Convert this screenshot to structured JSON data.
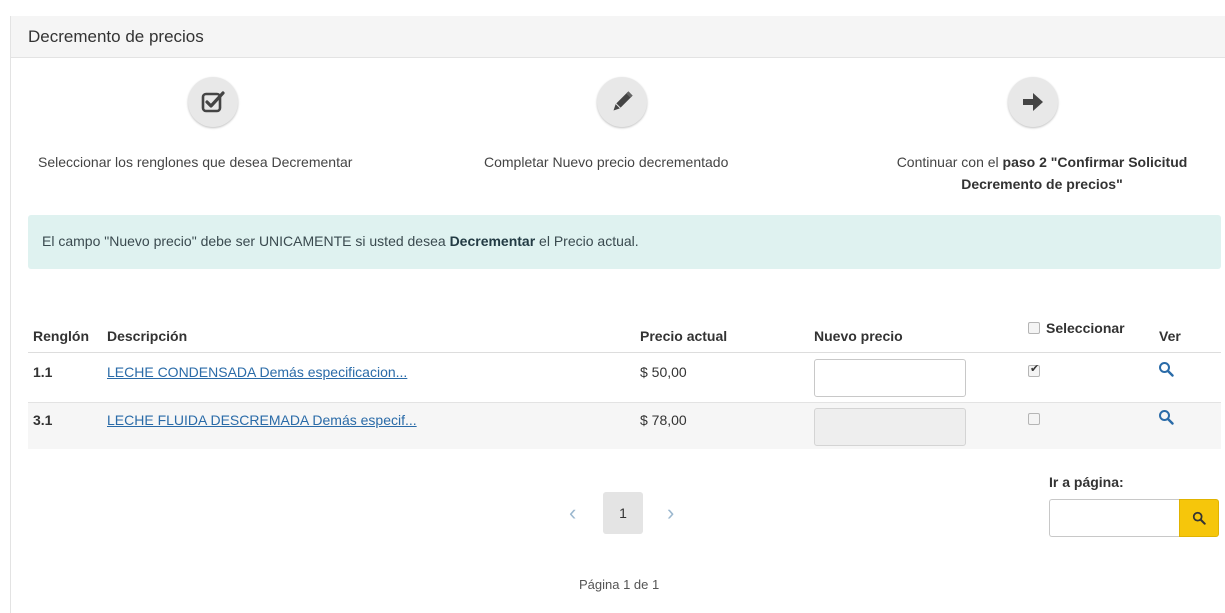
{
  "panel": {
    "title": "Decremento de precios"
  },
  "steps": [
    {
      "icon": "checkbox-edit-icon",
      "text": "Seleccionar los renglones que desea Decrementar"
    },
    {
      "icon": "pencil-icon",
      "text": "Completar Nuevo precio decrementado"
    },
    {
      "icon": "arrow-right-icon",
      "text_prefix": "Continuar con el ",
      "text_bold": "paso 2 \"Confirmar Solicitud",
      "text_bold_line2": "Decremento de precios\""
    }
  ],
  "alert": {
    "prefix": "El campo \"Nuevo precio\" debe ser UNICAMENTE si usted desea ",
    "bold": "Decrementar",
    "suffix": " el Precio actual."
  },
  "table": {
    "headers": {
      "renglon": "Renglón",
      "descripcion": "Descripción",
      "precio_actual": "Precio actual",
      "nuevo_precio": "Nuevo precio",
      "seleccionar": "Seleccionar",
      "ver": "Ver"
    },
    "rows": [
      {
        "renglon": "1.1",
        "descripcion": "LECHE CONDENSADA Demás especificacion...",
        "precio_actual": "$ 50,00",
        "nuevo_precio": "",
        "selected": true,
        "enabled": true
      },
      {
        "renglon": "3.1",
        "descripcion": "LECHE FLUIDA DESCREMADA Demás especif...",
        "precio_actual": "$ 78,00",
        "nuevo_precio": "",
        "selected": false,
        "enabled": false
      }
    ]
  },
  "pagination": {
    "prev": "‹",
    "current": "1",
    "next": "›",
    "info": "Página 1 de 1",
    "goto_label": "Ir a página:",
    "goto_value": ""
  },
  "colors": {
    "alert_bg": "#dff2f0",
    "link": "#2a6ba8",
    "goto_button": "#f6c60b",
    "search_icon": "#2a6ba8"
  }
}
